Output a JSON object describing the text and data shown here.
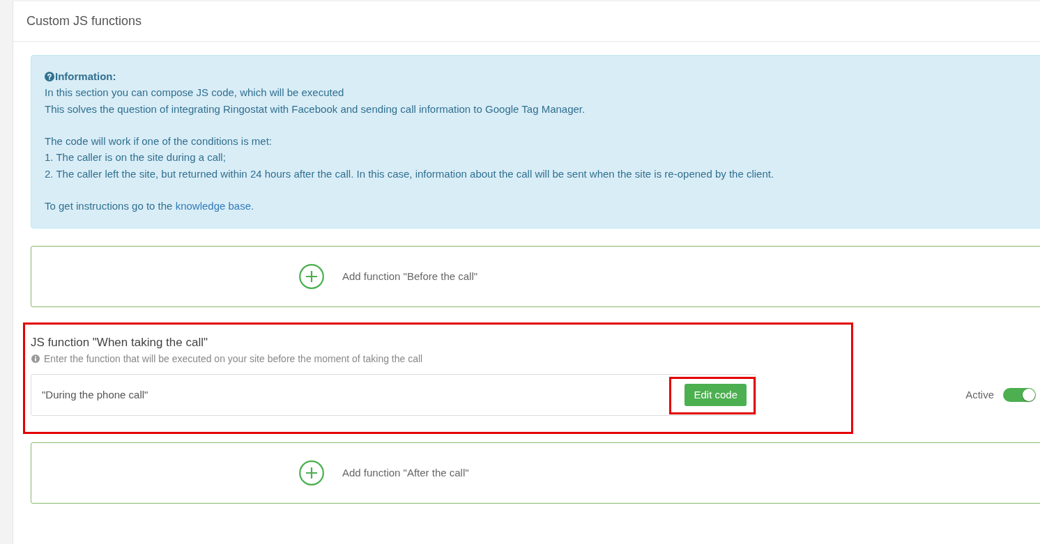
{
  "panel": {
    "title": "Custom JS functions"
  },
  "info": {
    "heading": "Information:",
    "paragraphs": [
      [
        "In this section you can compose JS code, which will be executed",
        "This solves the question of integrating Ringostat with Facebook and sending call information to Google Tag Manager."
      ],
      [
        "The code will work if one of the conditions is met:",
        "1. The caller is on the site during a call;",
        "2. The caller left the site, but returned within 24 hours after the call. In this case, information about the call will be sent when the site is re-opened by the client."
      ]
    ],
    "link_line": {
      "text": "To get instructions go to the ",
      "link": "knowledge base",
      "tail": "."
    }
  },
  "functions": [
    {
      "kind": "add",
      "label": "Add function \"Before the call\""
    },
    {
      "kind": "function",
      "title": "JS function \"When taking the call\"",
      "hint": "Enter the function that will be executed on your site before the moment of taking the call",
      "value": "\"During the phone call\"",
      "button": "Edit code",
      "status_label": "Active",
      "on": true,
      "highlighted": true,
      "button_highlighted": true
    },
    {
      "kind": "add",
      "label": "Add function \"After the call\""
    }
  ]
}
